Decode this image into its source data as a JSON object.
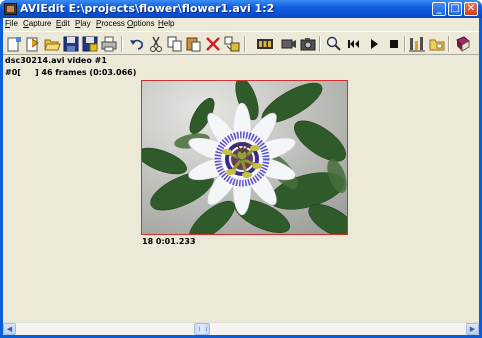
{
  "window": {
    "title": "AVIEdit E:\\projects\\flower\\flower1.avi  1:2",
    "controls": {
      "minimize": "_",
      "maximize": "□",
      "close": "✕"
    }
  },
  "menu": [
    "File",
    "Capture",
    "Edit",
    "Play",
    "Process",
    "Options",
    "Help"
  ],
  "toolbar": {
    "icons": [
      "new-icon",
      "open-icon",
      "open-folder-icon",
      "save-icon",
      "save-as-icon",
      "print-icon",
      "undo-icon",
      "cut-icon",
      "copy-icon",
      "paste-icon",
      "delete-icon",
      "insert-icon",
      "film-icon",
      "capture-camera-icon",
      "snapshot-icon",
      "zoom-icon",
      "rewind-icon",
      "play-icon",
      "stop-icon",
      "effects-icon",
      "folder-icon",
      "book-icon"
    ]
  },
  "stream": {
    "name": "dsc30214.avi video #1",
    "position_prefix": "#0[",
    "position_suffix": "] 46 frames (0:03.066)"
  },
  "frame": {
    "timestamp": "18 0:01.233",
    "content": "passion flower photo"
  },
  "scrollbar": {
    "position": 0.41
  }
}
